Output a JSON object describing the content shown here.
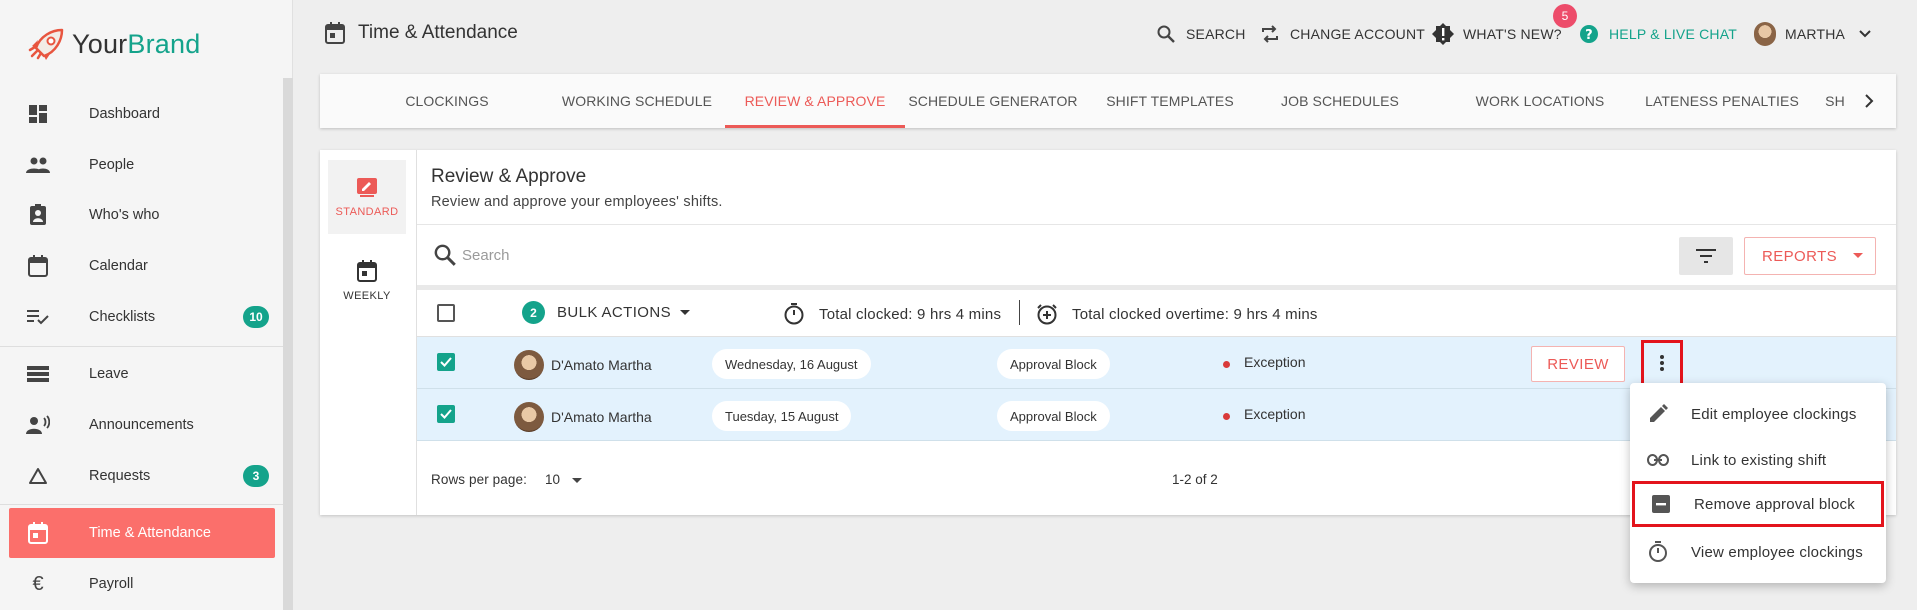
{
  "brand": {
    "prefix": "Your",
    "name": "Brand"
  },
  "sidebar": {
    "items": [
      {
        "label": "Dashboard",
        "icon": "dashboard-icon"
      },
      {
        "label": "People",
        "icon": "people-icon"
      },
      {
        "label": "Who's who",
        "icon": "contact-badge-icon"
      },
      {
        "label": "Calendar",
        "icon": "calendar-icon"
      },
      {
        "label": "Checklists",
        "icon": "checklist-icon",
        "badge": "10"
      },
      {
        "label": "Leave",
        "icon": "leave-icon"
      },
      {
        "label": "Announcements",
        "icon": "announcement-icon"
      },
      {
        "label": "Requests",
        "icon": "triangle-icon",
        "badge": "3"
      },
      {
        "label": "Time & Attendance",
        "icon": "calendar-today-icon",
        "active": true
      },
      {
        "label": "Payroll",
        "icon": "euro-icon"
      }
    ]
  },
  "topbar": {
    "title": "Time & Attendance",
    "search": "SEARCH",
    "change_account": "CHANGE ACCOUNT",
    "whats_new": "WHAT'S NEW?",
    "notif_count": "5",
    "help": "HELP & LIVE CHAT",
    "user": "MARTHA"
  },
  "tabs": [
    {
      "label": "CLOCKINGS"
    },
    {
      "label": "WORKING SCHEDULE"
    },
    {
      "label": "REVIEW & APPROVE",
      "active": true
    },
    {
      "label": "SCHEDULE GENERATOR"
    },
    {
      "label": "SHIFT TEMPLATES"
    },
    {
      "label": "JOB SCHEDULES"
    },
    {
      "label": "WORK LOCATIONS"
    },
    {
      "label": "LATENESS PENALTIES"
    },
    {
      "label": "SH"
    }
  ],
  "views": {
    "standard": "STANDARD",
    "weekly": "WEEKLY"
  },
  "main": {
    "title": "Review & Approve",
    "subtitle": "Review and approve your employees' shifts.",
    "search_placeholder": "Search",
    "reports": "REPORTS"
  },
  "bulk": {
    "count": "2",
    "label": "BULK ACTIONS",
    "total_clocked": "Total clocked: 9 hrs 4 mins",
    "total_overtime": "Total clocked overtime: 9 hrs 4 mins"
  },
  "rows": [
    {
      "name": "D'Amato Martha",
      "date": "Wednesday, 16 August",
      "block": "Approval Block",
      "status": "Exception",
      "action": "REVIEW"
    },
    {
      "name": "D'Amato Martha",
      "date": "Tuesday, 15 August",
      "block": "Approval Block",
      "status": "Exception"
    }
  ],
  "footer": {
    "rows_per_page": "Rows per page:",
    "rpp_value": "10",
    "range": "1-2 of 2"
  },
  "menu": [
    {
      "label": "Edit employee clockings",
      "icon": "pencil-icon"
    },
    {
      "label": "Link to existing shift",
      "icon": "link-icon"
    },
    {
      "label": "Remove approval block",
      "icon": "minus-box-icon",
      "highlighted": true
    },
    {
      "label": "View employee clockings",
      "icon": "stopwatch-icon"
    }
  ],
  "colors": {
    "accent": "#14a38b",
    "brand_red": "#ec5a57",
    "active_nav": "#fb6f6b",
    "highlight_box": "#e3141c",
    "row_bg": "#e3f2fd"
  }
}
